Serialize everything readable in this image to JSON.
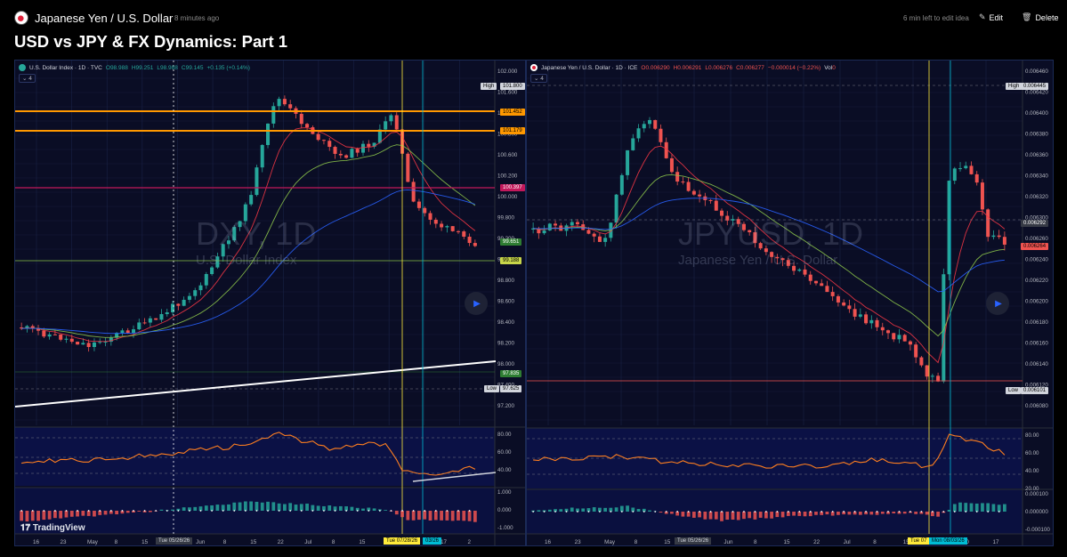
{
  "header": {
    "symbol_title": "Japanese Yen / U.S. Dollar",
    "time_ago": "8 minutes ago",
    "edit_time_left": "6 min left to edit idea",
    "edit_label": "Edit",
    "delete_label": "Delete",
    "page_title": "USD vs JPY & FX Dynamics: Part 1"
  },
  "left_chart": {
    "legend_name": "U.S. Dollar Index · 1D · TVC",
    "o": "O98.988",
    "h": "H99.251",
    "l": "L98.988",
    "c": "C99.145",
    "chg": "+0.135 (+0.14%)",
    "collapse": "⌄ 4",
    "watermark": "DXY, 1D",
    "watermark_sub": "U.S. Dollar Index",
    "price_ticks": [
      "102.000",
      "101.600",
      "101.000",
      "100.800",
      "100.600",
      "100.200",
      "100.000",
      "99.800",
      "99.200",
      "99.000",
      "98.800",
      "98.600",
      "98.400",
      "98.200",
      "98.000",
      "97.400",
      "97.200"
    ],
    "tags": {
      "high_label": "High",
      "high_value": "101.800",
      "orange1": "101.452",
      "orange2": "101.179",
      "magenta": "100.397",
      "last_price": "99.651",
      "green_level": "99.188",
      "support": "97.835",
      "low_label": "Low",
      "low_value": "97.625"
    },
    "rsi_ticks": [
      "80.00",
      "60.00",
      "40.00"
    ],
    "macd_ticks": [
      "1.000",
      "0.000",
      "-1.000"
    ],
    "dates": [
      "16",
      "23",
      "May",
      "8",
      "15",
      "22",
      "Jun",
      "8",
      "15",
      "22",
      "Jul",
      "8",
      "15",
      "22",
      "10",
      "17",
      "2"
    ],
    "date_tag_1": "Tue 05/26/26",
    "date_tag_2": "Tue 07/28/26",
    "date_tag_3": "03/26",
    "brand": "TradingView"
  },
  "right_chart": {
    "legend_name": "Japanese Yen / U.S. Dollar · 1D · ICE",
    "o": "O0.006290",
    "h": "H0.006291",
    "l": "L0.006276",
    "c": "C0.006277",
    "chg": "−0.000014 (−0.22%)",
    "vol": "Vol",
    "vol_value": "0",
    "collapse": "⌄ 4",
    "watermark": "JPYUSD, 1D",
    "watermark_sub": "Japanese Yen / U.S. Dollar",
    "price_ticks": [
      "0.006460",
      "0.006420",
      "0.006400",
      "0.006380",
      "0.006360",
      "0.006340",
      "0.006320",
      "0.006300",
      "0.006260",
      "0.006240",
      "0.006220",
      "0.006200",
      "0.006180",
      "0.006160",
      "0.006140",
      "0.006120",
      "0.006080"
    ],
    "tags": {
      "high_label": "High",
      "high_value": "0.006445",
      "crosshair": "0.006292",
      "last_price": "0.006264",
      "low_label": "Low",
      "low_value": "0.006101"
    },
    "rsi_ticks": [
      "80.00",
      "60.00",
      "40.00",
      "20.00"
    ],
    "macd_ticks": [
      "0.000100",
      "0.000000",
      "-0.000100"
    ],
    "dates": [
      "16",
      "23",
      "May",
      "8",
      "15",
      "22",
      "Jun",
      "8",
      "15",
      "22",
      "Jul",
      "8",
      "15",
      "2",
      "10",
      "17"
    ],
    "date_tag_1": "Tue 05/26/26",
    "date_tag_2": "Tue 07",
    "date_tag_3": "Mon 08/03/26"
  },
  "colors": {
    "up": "#26a69a",
    "down": "#ef5350",
    "orange": "#ff9800",
    "magenta": "#c2185b",
    "panel_bg": "#0a0d25",
    "ma_red": "#f23645",
    "ma_green": "#8bc34a",
    "ma_blue": "#2962ff",
    "rsi": "#ff7f1f",
    "crosshair_yellow": "#ffeb3b",
    "crosshair_cyan": "#00bcd4"
  },
  "icons": {
    "edit": "pencil-icon",
    "delete": "trash-icon",
    "play": "play-icon",
    "symbol": "flag-icon"
  }
}
